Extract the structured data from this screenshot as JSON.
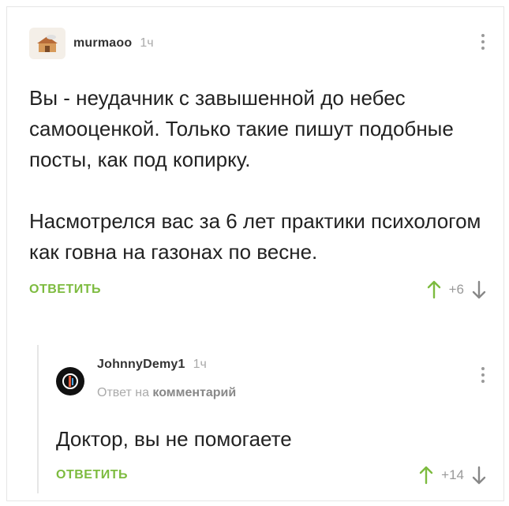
{
  "comment": {
    "username": "murmaoo",
    "time": "1ч",
    "body_p1": "Вы - неудачник с завышенной до небес самооценкой. Только такие пишут подобные посты, как под копирку.",
    "body_p2": "Насмотрелся вас за 6 лет практики психологом как говна на газонах по весне.",
    "reply_label": "ОТВЕТИТЬ",
    "score": "+6"
  },
  "reply": {
    "username": "JohnnyDemy1",
    "time": "1ч",
    "reply_to_prefix": "Ответ на",
    "reply_to_link": "комментарий",
    "body": "Доктор, вы не помогаете",
    "reply_label": "ОТВЕТИТЬ",
    "score": "+14"
  },
  "icons": {
    "upvote": "arrow-up-icon",
    "downvote": "arrow-down-icon",
    "menu": "more-vertical-icon"
  },
  "colors": {
    "accent_green": "#7dbb3f",
    "muted": "#aaaaaa"
  }
}
